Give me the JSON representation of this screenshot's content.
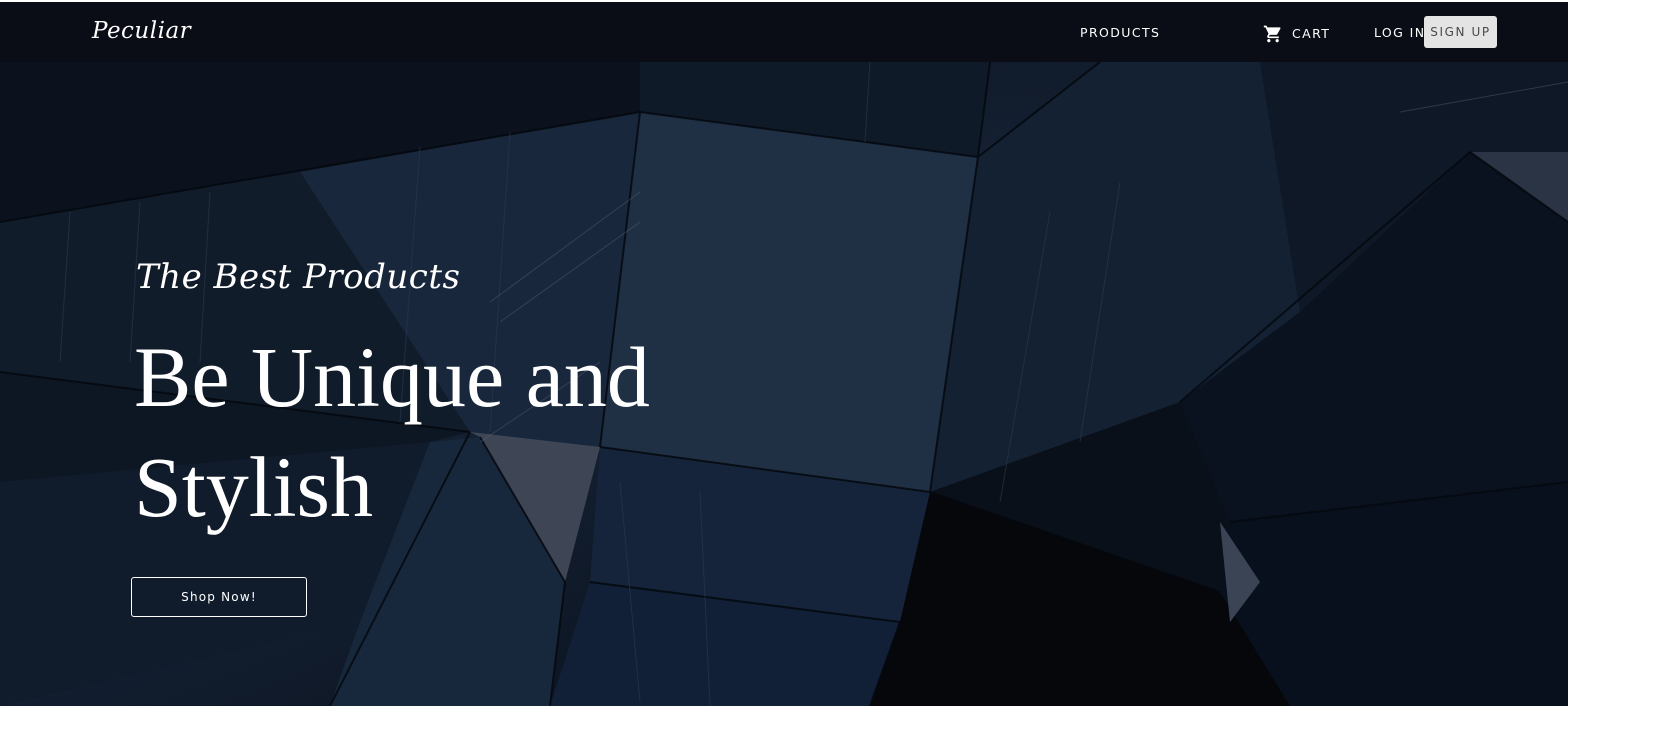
{
  "brand": {
    "name": "Peculiar"
  },
  "nav": {
    "products_label": "PRODUCTS",
    "cart_label": "CART",
    "cart_icon": "cart-icon",
    "login_label": "LOG IN",
    "signup_label": "SIGN UP"
  },
  "hero": {
    "tagline": "The Best Products",
    "headline_line1": "Be Unique and",
    "headline_line2": "Stylish",
    "cta_label": "Shop Now!",
    "background": "dark-geometric-glass-architecture"
  },
  "colors": {
    "navbar_bg": "#0b0d16",
    "hero_bg": "#0c1420",
    "text": "#ffffff",
    "signup_bg": "#e4e4e4",
    "signup_text": "#4a4a4a"
  }
}
